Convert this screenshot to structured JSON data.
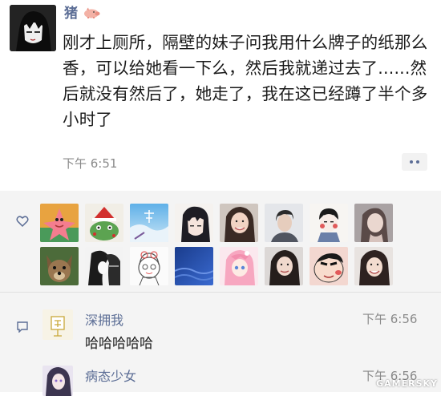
{
  "post": {
    "author": "猪",
    "content": "刚才上厕所，隔壁的妹子问我用什么牌子的纸那么香，可以给她看一下么，然后我就递过去了......然后就没有然后了，她走了，我在这已经蹲了半个多小时了",
    "time": "下午 6:51",
    "more_icon": "more-dots-icon"
  },
  "likes": {
    "icon": "heart-icon",
    "avatars": [
      "avatar-patrick-star",
      "avatar-christmas-frog",
      "avatar-blue-sky-text",
      "avatar-anime-girl-black-hair",
      "avatar-smiling-girl",
      "avatar-boy-portrait",
      "avatar-cartoon-boy-red-cheeks",
      "avatar-girl-gray",
      "avatar-cartoon-dog",
      "avatar-manga-sketch",
      "avatar-doodle-girl",
      "avatar-blue-ocean",
      "avatar-pink-hair-anime",
      "avatar-girl-selfie",
      "avatar-crayon-shinchan",
      "avatar-girl-smiling-2"
    ]
  },
  "comments": {
    "icon": "comment-icon",
    "items": [
      {
        "name": "深拥我",
        "time": "下午 6:56",
        "text": "哈哈哈哈哈"
      },
      {
        "name": "病态少女",
        "time": "下午 6:56",
        "text": ""
      }
    ]
  },
  "colors": {
    "link": "#5b6d95",
    "meta": "#8a8a8a",
    "panel": "#f4f4f4"
  },
  "watermark": "GAMERSKY"
}
